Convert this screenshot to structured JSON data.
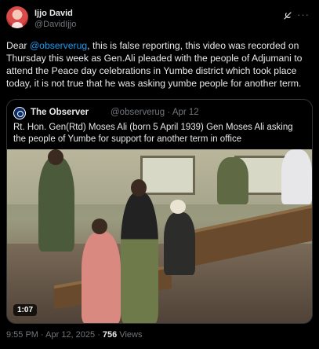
{
  "author": {
    "name": "Ijjo David",
    "handle": "@DavidIjjo",
    "icons": [
      "grok-icon",
      "more-icon"
    ],
    "more_glyph": "···"
  },
  "tweet": {
    "prefix": "Dear ",
    "mention": "@observerug",
    "body": ", this is false reporting, this video was recorded on Thursday this week as Gen.Ali pleaded with the people of Adjumani to attend the Peace day celebrations in Yumbe district which took place today, it is not true that he was asking yumbe people for another term."
  },
  "quote": {
    "name": "The Observer",
    "handle": "@observerug",
    "date": "Apr 12",
    "text": "Rt. Hon. Gen(Rtd) Moses Ali (born 5 April 1939) Gen Moses Ali asking the people of Yumbe for support for another term in office",
    "video_duration": "1:07"
  },
  "footer": {
    "time": "9:55 PM",
    "date": "Apr 12, 2025",
    "views_count": "756",
    "views_label": "Views"
  },
  "colors": {
    "background": "#000000",
    "text": "#e7e9ea",
    "muted": "#71767b",
    "link": "#1d9bf0",
    "border": "#2f3336"
  }
}
